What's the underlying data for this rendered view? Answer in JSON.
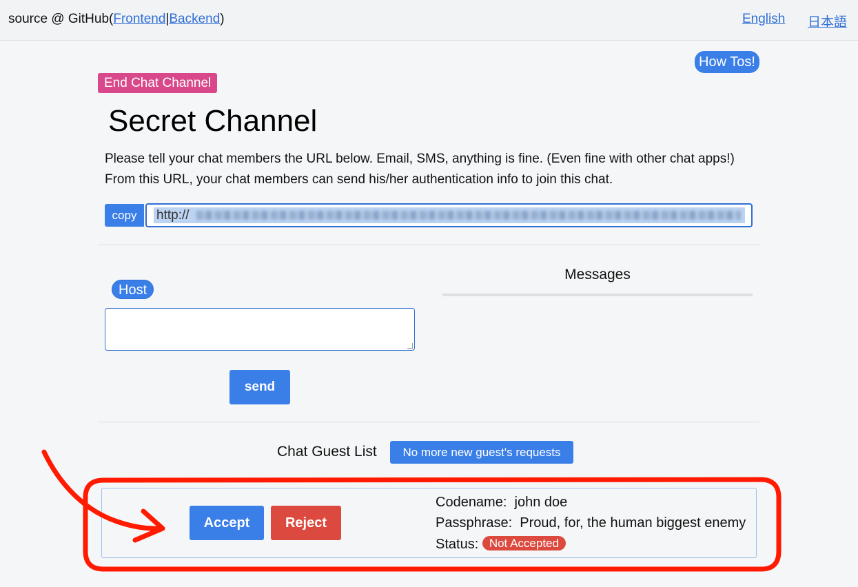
{
  "header": {
    "brand_prefix": "source @ GitHub(",
    "frontend_link": "Frontend",
    "separator": "|",
    "backend_link": "Backend",
    "brand_suffix": ")",
    "lang_english": "English",
    "lang_japanese": "日本語"
  },
  "howtos_label": "How Tos!",
  "end_chat_label": "End Chat Channel",
  "page_title": "Secret Channel",
  "description": "Please tell your chat members the URL below. Email, SMS, anything is fine. (Even fine with other chat apps!) From this URL, your chat members can send his/her authentication info to join this chat.",
  "share": {
    "copy_label": "copy",
    "url_visible_prefix": "http://"
  },
  "composer": {
    "host_badge": "Host",
    "message_value": "",
    "send_label": "send"
  },
  "messages": {
    "title": "Messages"
  },
  "guests": {
    "title": "Chat Guest List",
    "status_button": "No more new guest's requests",
    "items": [
      {
        "accept_label": "Accept",
        "reject_label": "Reject",
        "codename_label": "Codename:",
        "codename_value": "john doe",
        "passphrase_label": "Passphrase:",
        "passphrase_value": "Proud, for, the human biggest enemy",
        "status_label": "Status:",
        "status_value": "Not Accepted"
      }
    ]
  },
  "colors": {
    "primary": "#3a7ee8",
    "danger": "#dc4a3f",
    "pink": "#d9488a",
    "annotation": "#ff1a00"
  },
  "icons": [
    "hand-drawn-arrow-annotation",
    "hand-drawn-highlight-box"
  ]
}
